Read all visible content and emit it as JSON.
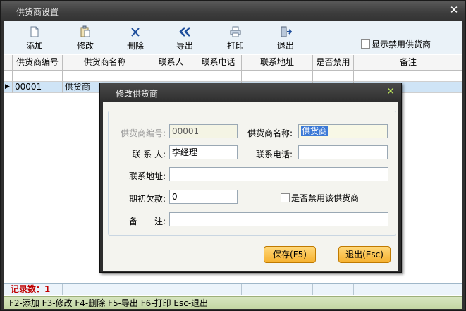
{
  "window": {
    "title": "供货商设置"
  },
  "toolbar": {
    "add": "添加",
    "edit": "修改",
    "delete": "删除",
    "export": "导出",
    "print": "打印",
    "exit": "退出",
    "show_disabled": "显示禁用供货商"
  },
  "table": {
    "columns": [
      "供货商编号",
      "供货商名称",
      "联系人",
      "联系电话",
      "联系地址",
      "是否禁用",
      "备注"
    ],
    "rows": [
      {
        "code": "00001",
        "name": "供货商"
      }
    ]
  },
  "footer": {
    "record_count": "记录数：1"
  },
  "statusbar": {
    "text": "F2-添加 F3-修改 F4-删除 F5-导出 F6-打印 Esc-退出"
  },
  "dialog": {
    "title": "修改供货商",
    "labels": {
      "code": "供货商编号:",
      "name": "供货商名称:",
      "contact": "联 系 人:",
      "phone": "联系电话:",
      "address": "联系地址:",
      "initial_debt": "期初欠款:",
      "remark": "备　　注:",
      "disable": "是否禁用该供货商"
    },
    "values": {
      "code": "00001",
      "name": "供货商",
      "contact": "李经理",
      "phone": "",
      "address": "",
      "initial_debt": "0",
      "remark": ""
    },
    "buttons": {
      "save": "保存(F5)",
      "cancel": "退出(Esc)"
    }
  }
}
